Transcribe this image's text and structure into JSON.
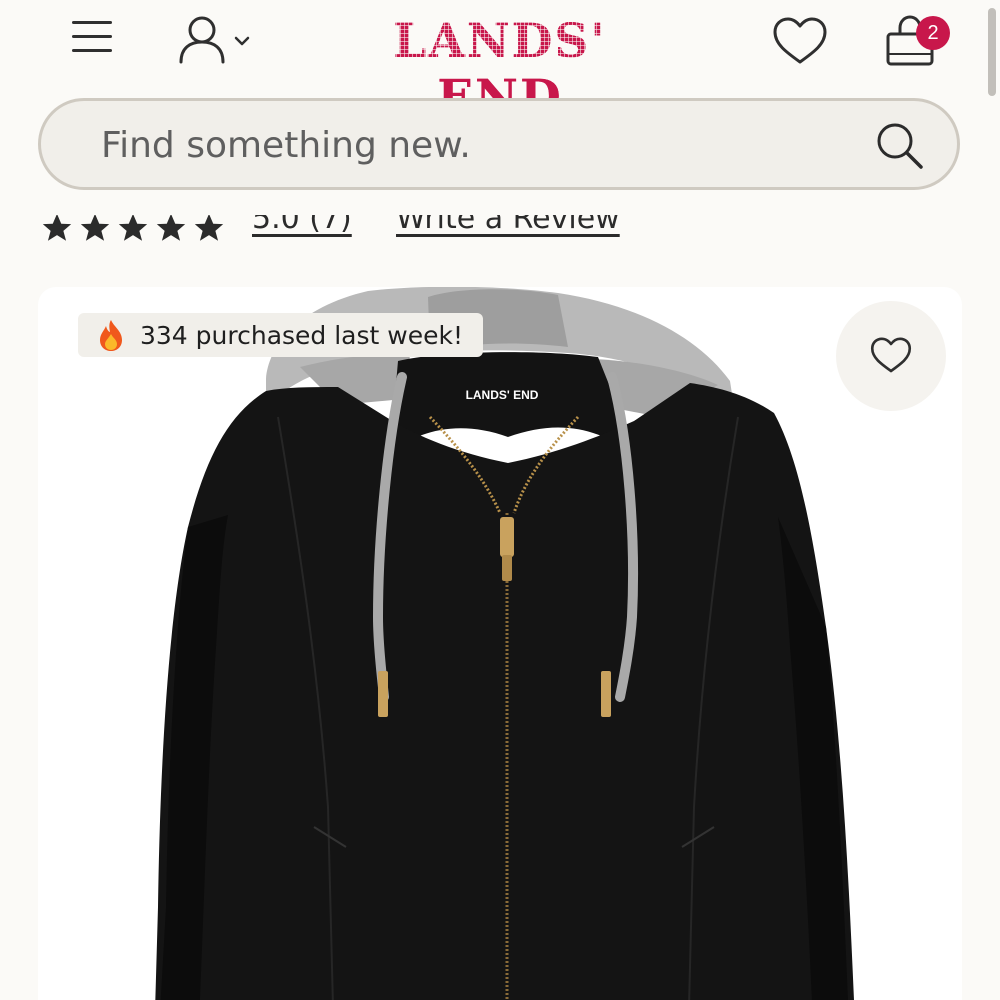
{
  "header": {
    "brand": "LANDS' END",
    "cart_count": "2"
  },
  "search": {
    "placeholder": "Find something new."
  },
  "rating": {
    "score_link": "5.0 (7)",
    "write_review": "Write a Review"
  },
  "product": {
    "purchase_badge": "334 purchased last week!",
    "jacket_label": "LANDS' END"
  },
  "colors": {
    "brand": "#c8174b",
    "background": "#fbfaf7",
    "search_fill": "#f1efea",
    "search_border": "#cfcac1"
  },
  "icons": {
    "menu": "hamburger-menu-icon",
    "account": "user-icon",
    "account_dropdown": "chevron-down-icon",
    "wishlist": "heart-icon",
    "cart": "shopping-bag-icon",
    "search": "search-icon",
    "rating": "star-icon",
    "badge": "fire-icon"
  }
}
